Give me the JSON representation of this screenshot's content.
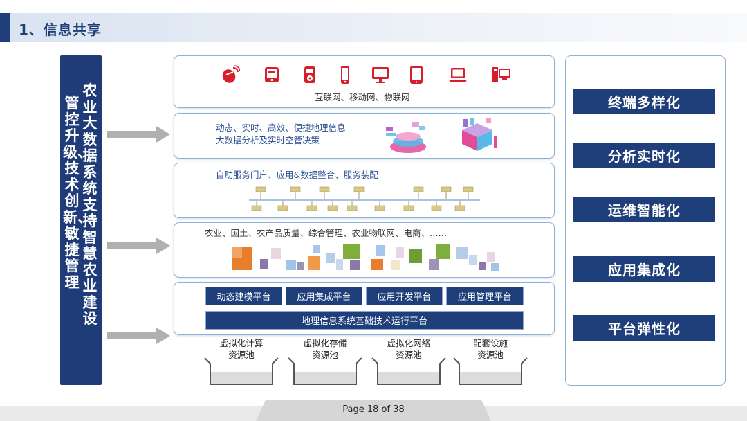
{
  "page": {
    "title": "1、信息共享",
    "footer": "Page 18 of 38"
  },
  "left_box": {
    "col_right": "农业大数据系统支持智慧农业建设",
    "col_left": "管控升级、技术创新、敏捷管理"
  },
  "layers": {
    "terminal": {
      "label": "互联网、移动网、物联网",
      "icons": [
        "satellite-icon",
        "tablet-icon",
        "media-player-icon",
        "phone-icon",
        "monitor-icon",
        "tablet-icon",
        "laptop-icon",
        "desktop-pc-icon"
      ]
    },
    "analysis": {
      "line1": "动态、实时、高效、便捷地理信息",
      "line2": "大数据分析及实时空管决策"
    },
    "service": {
      "label": "自助服务门户、应用&数据整合、服务装配"
    },
    "application": {
      "label": "农业、国土、农产品质量、综合管理、农业物联网、电商、……"
    },
    "platform": {
      "top": [
        "动态建模平台",
        "应用集成平台",
        "应用开发平台",
        "应用管理平台"
      ],
      "base": "地理信息系统基础技术运行平台"
    }
  },
  "pools": [
    {
      "line1": "虚拟化计算",
      "line2": "资源池"
    },
    {
      "line1": "虚拟化存储",
      "line2": "资源池"
    },
    {
      "line1": "虚拟化网络",
      "line2": "资源池"
    },
    {
      "line1": "配套设施",
      "line2": "资源池"
    }
  ],
  "features": [
    "终端多样化",
    "分析实时化",
    "运维智能化",
    "应用集成化",
    "平台弹性化"
  ],
  "colors": {
    "navy": "#1f3f7a",
    "border": "#8eb1d6",
    "icon_red": "#d81e2c",
    "arrow": "#a6a6a6"
  }
}
